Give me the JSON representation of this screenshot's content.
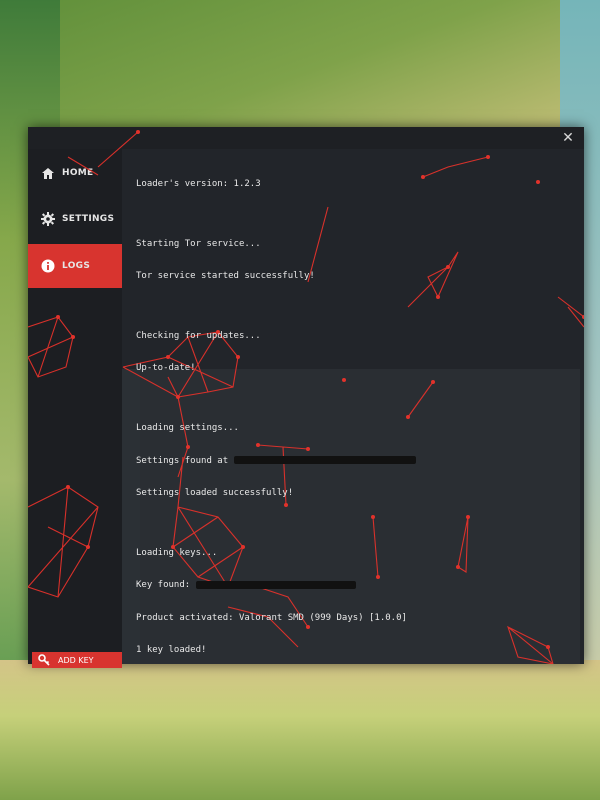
{
  "window": {
    "close_icon": "close-icon"
  },
  "sidebar": {
    "items": [
      {
        "label": "HOME",
        "icon": "home-icon",
        "active": false
      },
      {
        "label": "SETTINGS",
        "icon": "gear-icon",
        "active": false
      },
      {
        "label": "LOGS",
        "icon": "info-icon",
        "active": true
      }
    ],
    "add_key": {
      "label": "ADD KEY",
      "icon": "key-icon"
    }
  },
  "log": {
    "group1": [
      "Loader's version: 1.2.3"
    ],
    "group2": [
      "Starting Tor service...",
      "Tor service started successfully!"
    ],
    "group3": [
      "Checking for updates...",
      "Up-to-date!"
    ],
    "group4": [
      "Loading settings...",
      "Settings found at",
      "Settings loaded successfully!"
    ],
    "group5": [
      "Loading keys...",
      "Key found:",
      "Product activated: Valorant SMD (999 Days) [1.0.0]",
      "1 key loaded!"
    ]
  },
  "colors": {
    "accent": "#d8342f",
    "window_bg": "#1e2024",
    "text": "#e9e9e9"
  }
}
